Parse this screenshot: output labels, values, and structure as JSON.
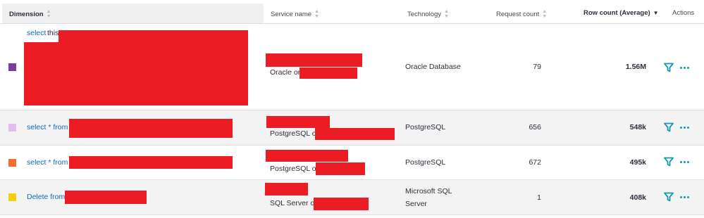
{
  "header": {
    "dimension": "Dimension",
    "service_name": "Service name",
    "technology": "Technology",
    "request_count": "Request count",
    "row_count": "Row count (Average)",
    "actions": "Actions"
  },
  "icons": {
    "sort": "sort-icon",
    "sort_active": "sort-descending-icon",
    "filter": "filter-icon",
    "more": "more-icon"
  },
  "colors": {
    "link": "#1169b3",
    "accent": "#1498b5",
    "redaction": "#ec1c24"
  },
  "rows": [
    {
      "color": "#7b3ca2",
      "dimension": "select",
      "dimension_tail": "this",
      "service_prefix": "Oracle on",
      "technology": "Oracle Database",
      "request_count": "79",
      "row_count": "1.56M"
    },
    {
      "color": "#e3bdf0",
      "dimension": "select * from",
      "service_prefix": "PostgreSQL on",
      "technology": "PostgreSQL",
      "request_count": "656",
      "row_count": "548k"
    },
    {
      "color": "#f26d2e",
      "dimension": "select * from",
      "service_prefix": "PostgreSQL on",
      "technology": "PostgreSQL",
      "request_count": "672",
      "row_count": "495k"
    },
    {
      "color": "#f8cd0e",
      "dimension": "Delete from",
      "service_prefix": "SQL Server on",
      "technology": "Microsoft SQL Server",
      "request_count": "1",
      "row_count": "408k"
    }
  ]
}
